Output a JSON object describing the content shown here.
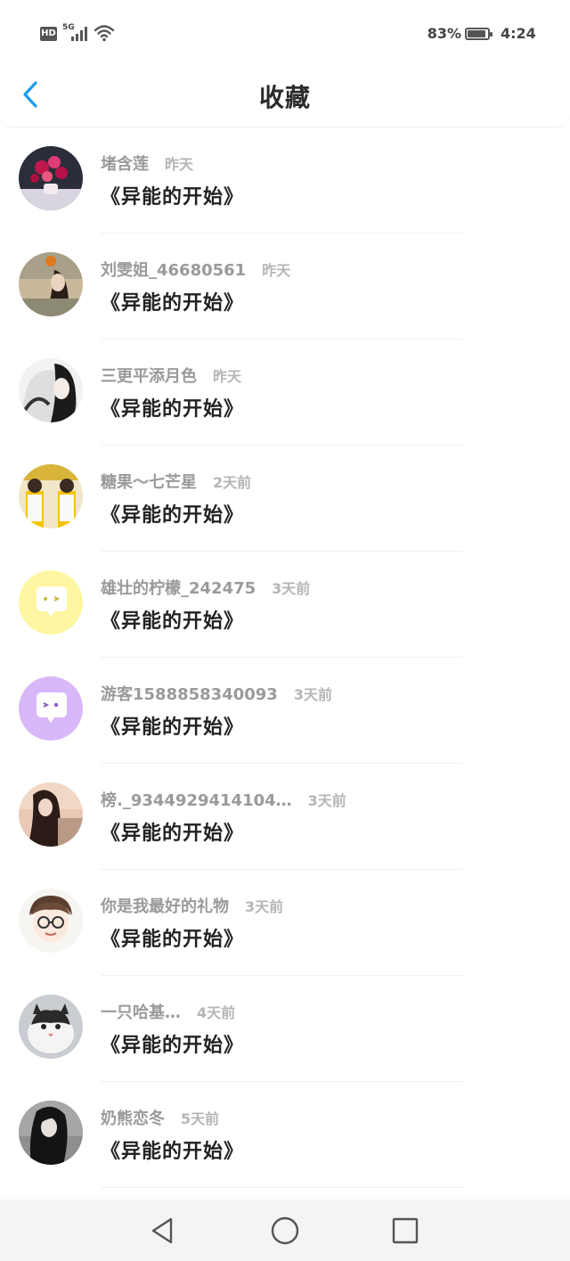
{
  "status_bar": {
    "hd": "HD",
    "network": "5G",
    "battery_percent": "83%",
    "time": "4:24",
    "icons": [
      "hd-icon",
      "signal-icon",
      "wifi-icon",
      "battery-icon"
    ]
  },
  "header": {
    "title": "收藏",
    "back_icon": "chevron-left-icon",
    "accent_color": "#1e9bf0"
  },
  "favorites": [
    {
      "username": "堵含莲",
      "time": "昨天",
      "book": "《异能的开始》",
      "avatar": "flowers-photo"
    },
    {
      "username": "刘雯姐_46680561",
      "time": "昨天",
      "book": "《异能的开始》",
      "avatar": "woman-autumn-photo"
    },
    {
      "username": "三更平添月色",
      "time": "昨天",
      "book": "《异能的开始》",
      "avatar": "girl-wolf-photo"
    },
    {
      "username": "糖果～七芒星",
      "time": "2天前",
      "book": "《异能的开始》",
      "avatar": "couple-yellow-photo"
    },
    {
      "username": "雄壮的柠檬_242475",
      "time": "3天前",
      "book": "《异能的开始》",
      "avatar": "yellow-chat-bubble-icon"
    },
    {
      "username": "游客1588858340093",
      "time": "3天前",
      "book": "《异能的开始》",
      "avatar": "purple-chat-bubble-icon"
    },
    {
      "username": "榜._9344929414104…",
      "time": "3天前",
      "book": "《异能的开始》",
      "avatar": "girl-sunset-photo"
    },
    {
      "username": "你是我最好的礼物",
      "time": "3天前",
      "book": "《异能的开始》",
      "avatar": "boy-glasses-drawing"
    },
    {
      "username": "一只哈基…",
      "time": "4天前",
      "book": "《异能的开始》",
      "avatar": "cat-photo"
    },
    {
      "username": "奶熊恋冬",
      "time": "5天前",
      "book": "《异能的开始》",
      "avatar": "girl-dark-photo"
    }
  ],
  "nav_bar": {
    "icons": [
      "back-triangle-icon",
      "home-circle-icon",
      "recent-square-icon"
    ]
  }
}
